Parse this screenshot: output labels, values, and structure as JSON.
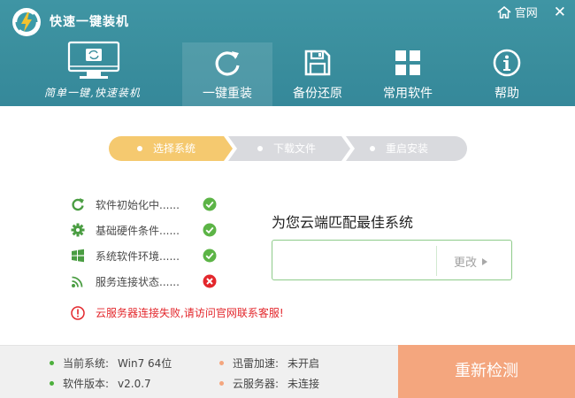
{
  "app": {
    "title": "快速一键装机",
    "slogan": "简单一键,快速装机",
    "home_link": "官网",
    "close_glyph": "✕"
  },
  "nav": [
    {
      "label": "一键重装",
      "icon": "refresh-icon",
      "active": true
    },
    {
      "label": "备份还原",
      "icon": "floppy-disk-icon",
      "active": false
    },
    {
      "label": "常用软件",
      "icon": "apps-grid-icon",
      "active": false
    },
    {
      "label": "帮助",
      "icon": "info-icon",
      "active": false
    }
  ],
  "steps": [
    {
      "label": "选择系统",
      "active": true
    },
    {
      "label": "下载文件",
      "active": false
    },
    {
      "label": "重启安装",
      "active": false
    }
  ],
  "checks": [
    {
      "label": "软件初始化中......",
      "icon": "sync-icon",
      "status": "ok"
    },
    {
      "label": "基础硬件条件......",
      "icon": "gear-icon",
      "status": "ok"
    },
    {
      "label": "系统软件环境......",
      "icon": "windows-logo-icon",
      "status": "ok"
    },
    {
      "label": "服务连接状态......",
      "icon": "signal-icon",
      "status": "fail"
    }
  ],
  "error_message": "云服务器连接失败,请访问官网联系客服!",
  "match": {
    "title": "为您云端匹配最佳系统",
    "system_value": "",
    "change_label": "更改"
  },
  "footer": {
    "current_system_label": "当前系统:",
    "current_system_value": "Win7 64位",
    "software_version_label": "软件版本:",
    "software_version_value": "v2.0.7",
    "thunder_label": "迅雷加速:",
    "thunder_value": "未开启",
    "cloud_server_label": "云服务器:",
    "cloud_server_value": "未连接",
    "recheck_label": "重新检测"
  },
  "colors": {
    "header": "#3a8e9d",
    "step_active": "#f5c96f",
    "step_inactive": "#d9dade",
    "ok_green": "#5cb446",
    "error_red": "#e3272c",
    "icon_green": "#4a9d42",
    "recheck_orange": "#f4a67e",
    "bullet_green": "#4caf3c",
    "bullet_orange": "#f4a67e"
  }
}
